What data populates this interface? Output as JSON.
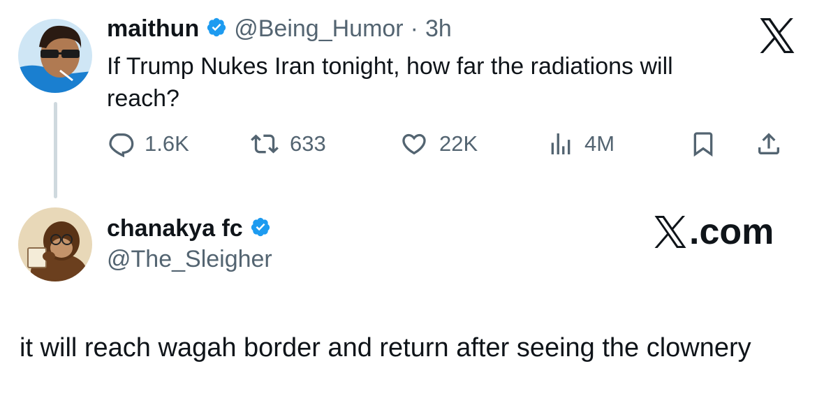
{
  "original_tweet": {
    "display_name": "maithun",
    "handle": "@Being_Humor",
    "separator": "·",
    "time": "3h",
    "text": "If Trump Nukes Iran tonight, how far the radiations will reach?",
    "avatar_icon": "avatar-person-sunglasses",
    "verified": true,
    "actions": {
      "replies": "1.6K",
      "reposts": "633",
      "likes": "22K",
      "views": "4M"
    }
  },
  "reply_tweet": {
    "display_name": "chanakya fc",
    "handle": "@The_Sleigher",
    "avatar_icon": "avatar-monkey-reading",
    "verified": true,
    "text": "it will reach wagah border and return after seeing the clownery"
  },
  "branding": {
    "domain_suffix": ".com",
    "logo_icon": "x-logo-icon"
  },
  "colors": {
    "verified_blue": "#1d9bf0",
    "text_primary": "#0f1419",
    "text_secondary": "#536471",
    "thread_line": "#cfd9de"
  }
}
